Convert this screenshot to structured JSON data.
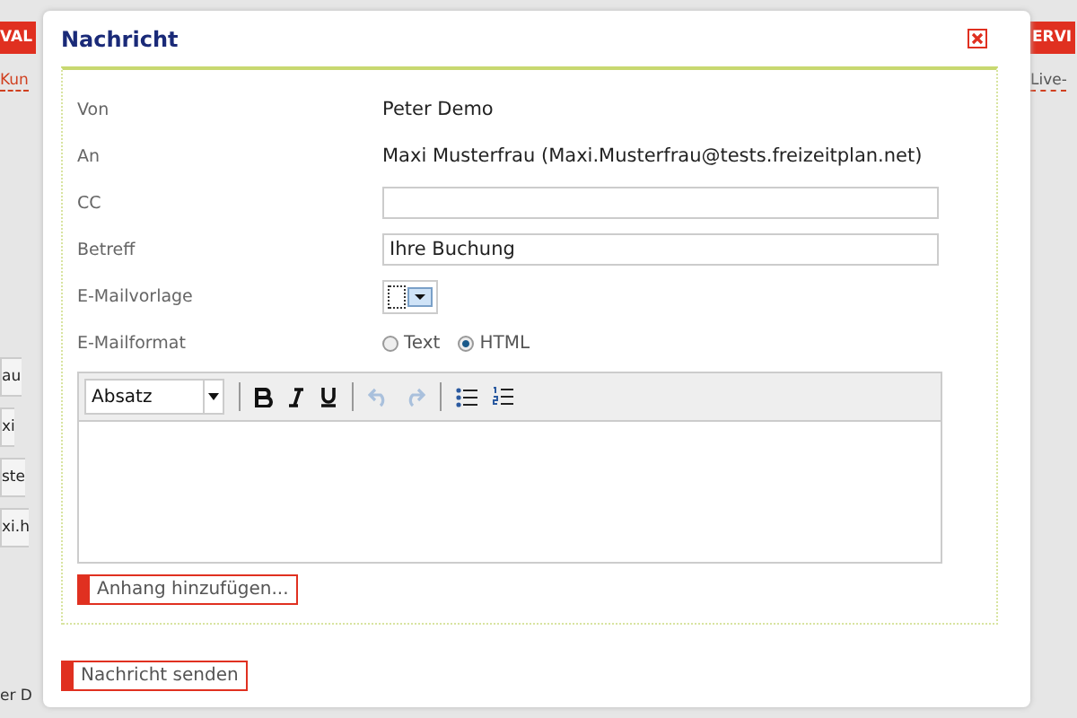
{
  "background": {
    "left_banner": "VAL",
    "right_banner": "ERVI",
    "left_link": "Kun",
    "right_link": "Live-",
    "left_items": [
      {
        "text": "au"
      },
      {
        "text": "xi"
      },
      {
        "text": "ste"
      },
      {
        "text": "xi.h"
      }
    ],
    "left_footer": "er D"
  },
  "dialog": {
    "title": "Nachricht",
    "fields": [
      {
        "label": "Von",
        "kind": "text",
        "value": "Peter Demo"
      },
      {
        "label": "An",
        "kind": "text",
        "value": "Maxi Musterfrau (Maxi.Musterfrau@tests.freizeitplan.net)"
      },
      {
        "label": "CC",
        "kind": "input"
      },
      {
        "label": "Betreff",
        "kind": "input",
        "value": "Ihre Buchung"
      },
      {
        "label": "E-Mailvorlage",
        "kind": "select"
      },
      {
        "label": "E-Mailformat",
        "kind": "radio",
        "options": [
          {
            "label": "Text",
            "selected": false
          },
          {
            "label": "HTML",
            "selected": true
          }
        ]
      }
    ],
    "editor": {
      "format": "Absatz"
    },
    "attach_button": "Anhang hinzufügen...",
    "send_button": "Nachricht senden"
  }
}
